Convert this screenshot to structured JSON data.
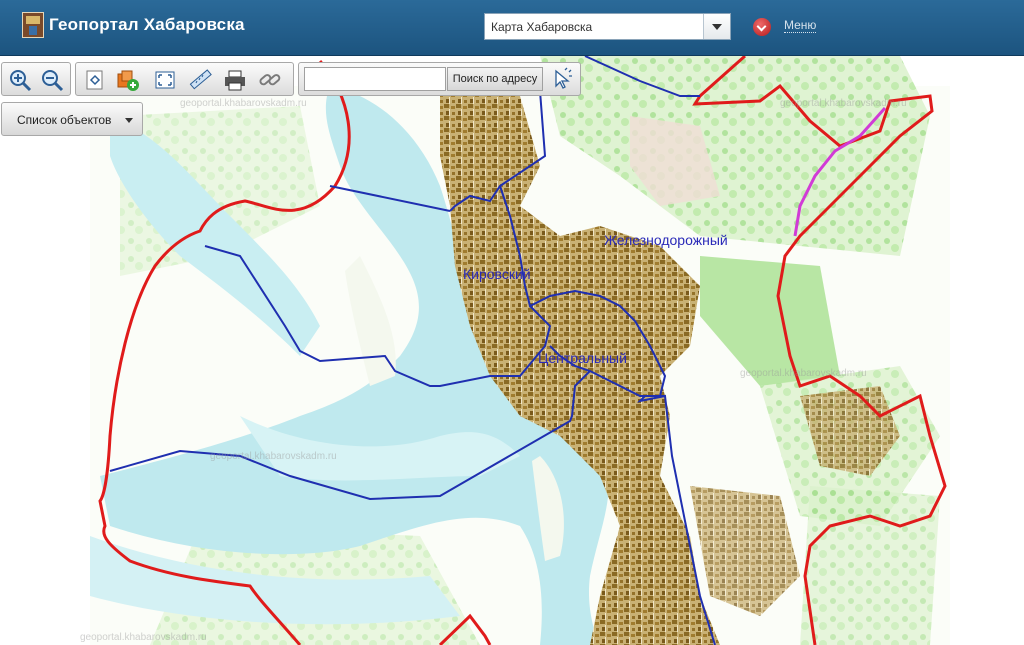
{
  "header": {
    "title": "Геопортал Хабаровска",
    "layer_select": {
      "value": "Карта Хабаровска"
    },
    "menu_label": "Меню"
  },
  "toolbar": {
    "search": {
      "value": "",
      "button_label": "Поиск по адресу"
    },
    "tools": [
      {
        "name": "zoom-in-icon"
      },
      {
        "name": "zoom-out-icon"
      },
      {
        "name": "full-extent-icon"
      },
      {
        "name": "add-layer-icon"
      },
      {
        "name": "fullscreen-icon"
      },
      {
        "name": "measure-ruler-icon"
      },
      {
        "name": "print-icon"
      },
      {
        "name": "link-icon"
      },
      {
        "name": "identify-cursor-icon"
      }
    ]
  },
  "objects_button": {
    "label": "Список объектов"
  },
  "map": {
    "districts": [
      {
        "name": "Железнодорожный"
      },
      {
        "name": "Кировский"
      },
      {
        "name": "Центральный"
      }
    ],
    "watermarks": [
      "geoportal.khabarovskadm.ru",
      "geoportal.khabarovskadm.ru",
      "geoportal.khabarovskadm.ru",
      "geoportal.khabarovskadm.ru",
      "geoportal.khabarovskadm.ru"
    ],
    "colors": {
      "river": "#bfe9ee",
      "greenery": "#b6e6a3",
      "built_up": "#b08b3c",
      "city_boundary": "#e01b1b",
      "district_boundary": "#1f2fb0",
      "highlight": "#d13bd6"
    }
  }
}
